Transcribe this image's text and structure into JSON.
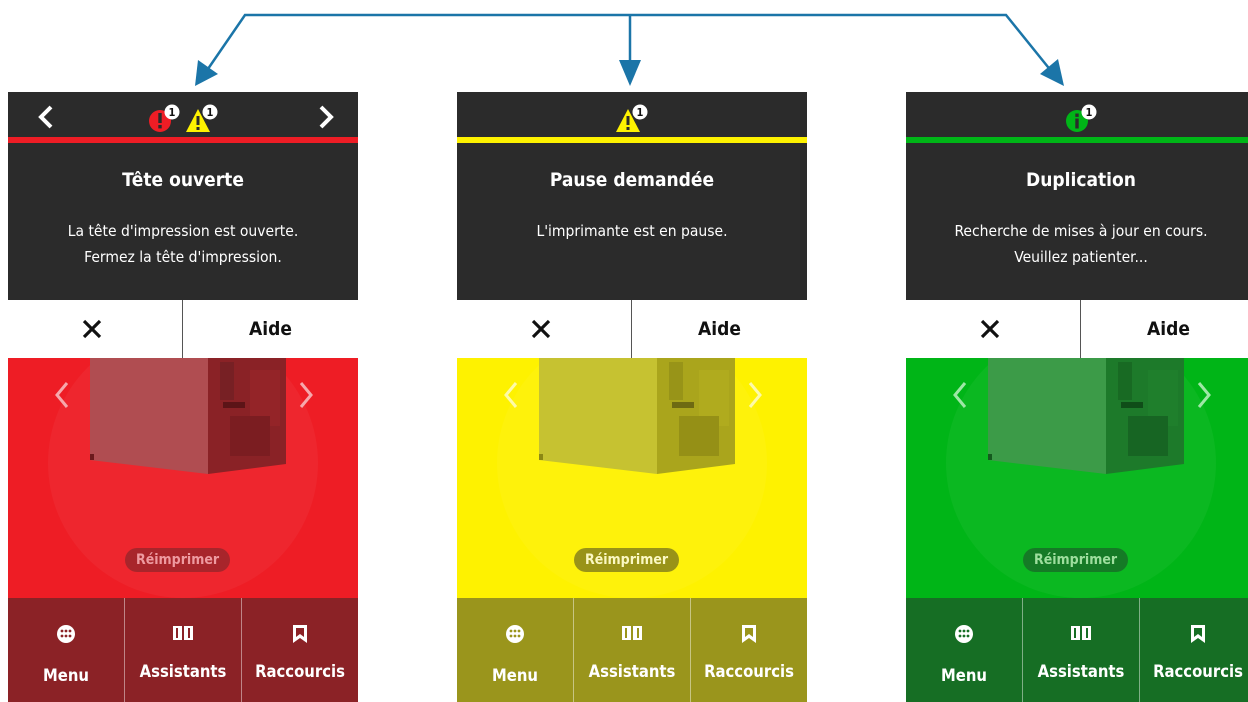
{
  "colors": {
    "arrow": "#1b75a8",
    "dark_bg": "#2b2b2b",
    "red": "#ee1d25",
    "red_nav": "#8b2226",
    "red_btn": "#a8252b",
    "red_btn_text": "#ee9aa0",
    "yellow": "#fef200",
    "yellow_nav": "#9a951c",
    "yellow_btn": "#999318",
    "yellow_btn_text": "#fbf8c2",
    "green": "#00b517",
    "green_nav": "#166e24",
    "green_btn": "#157a26",
    "green_btn_text": "#9ede9e"
  },
  "panels": [
    {
      "id": "error",
      "has_nav_arrows": true,
      "alert_icons": [
        {
          "type": "error-alert-icon",
          "count": "1"
        },
        {
          "type": "warning-alert-icon",
          "count": "1"
        }
      ],
      "title": "Tête ouverte",
      "message_lines": [
        "La tête d'impression est ouverte.",
        "Fermez la tête d'impression."
      ],
      "dismiss_icon": "close-icon",
      "help_label": "Aide",
      "reprint_label": "Réimprimer",
      "nav": [
        {
          "icon": "menu-grid-icon",
          "label": "Menu"
        },
        {
          "icon": "book-icon",
          "label": "Assistants"
        },
        {
          "icon": "bookmark-icon",
          "label": "Raccourcis"
        }
      ]
    },
    {
      "id": "warning",
      "has_nav_arrows": false,
      "alert_icons": [
        {
          "type": "warning-alert-icon",
          "count": "1"
        }
      ],
      "title": "Pause demandée",
      "message_lines": [
        "L'imprimante est en pause."
      ],
      "dismiss_icon": "close-icon",
      "help_label": "Aide",
      "reprint_label": "Réimprimer",
      "nav": [
        {
          "icon": "menu-grid-icon",
          "label": "Menu"
        },
        {
          "icon": "book-icon",
          "label": "Assistants"
        },
        {
          "icon": "bookmark-icon",
          "label": "Raccourcis"
        }
      ]
    },
    {
      "id": "info",
      "has_nav_arrows": false,
      "alert_icons": [
        {
          "type": "info-alert-icon",
          "count": "1"
        }
      ],
      "title": "Duplication",
      "message_lines": [
        "Recherche de mises à jour en cours.",
        "Veuillez patienter..."
      ],
      "dismiss_icon": "close-icon",
      "help_label": "Aide",
      "reprint_label": "Réimprimer",
      "nav": [
        {
          "icon": "menu-grid-icon",
          "label": "Menu"
        },
        {
          "icon": "book-icon",
          "label": "Assistants"
        },
        {
          "icon": "bookmark-icon",
          "label": "Raccourcis"
        }
      ]
    }
  ]
}
